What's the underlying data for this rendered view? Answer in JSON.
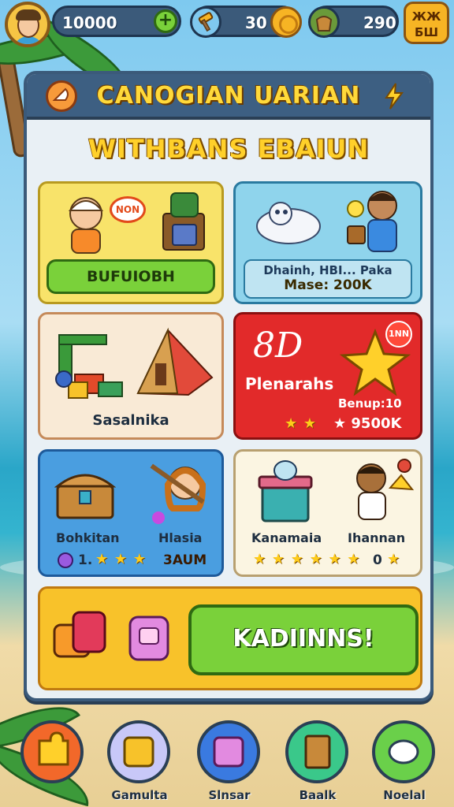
{
  "topbar": {
    "currency1": "10000",
    "currency2": "30",
    "currency3": "290",
    "corner_button": "ЖЖ\nБШ"
  },
  "panel": {
    "title": "CANOGIAN UARIAN",
    "subtitle": "WITHBANS EBAIUN"
  },
  "cards": {
    "c1": {
      "speech": "NON",
      "button": "BUFUIOBH"
    },
    "c2": {
      "line1": "Dhainh, HBI... Paka",
      "line2": "Mase: 200K"
    },
    "c3": {
      "label": "Sasalnika"
    },
    "c4": {
      "big": "8D",
      "label": "Plenarahs",
      "badge": "1NN",
      "line1": "Benup:10",
      "value": "★ 9500K"
    },
    "c5": {
      "left_label": "Bohkitan",
      "right_label": "Hlasia",
      "prefix": "1.",
      "value": "3AUM"
    },
    "c6": {
      "left_label": "Kanamaia",
      "right_label": "Ihannan",
      "count": "0"
    },
    "c7": {
      "button": "KADIINNS!"
    }
  },
  "nav": [
    {
      "label": ""
    },
    {
      "label": "Gamulta"
    },
    {
      "label": "Slnsar"
    },
    {
      "label": "Baalk"
    },
    {
      "label": "Noelal"
    }
  ],
  "colors": {
    "panel_header": "#3d5f82",
    "accent_yellow": "#ffd02a",
    "button_green": "#7ad13a",
    "card_red": "#e22a2a"
  }
}
